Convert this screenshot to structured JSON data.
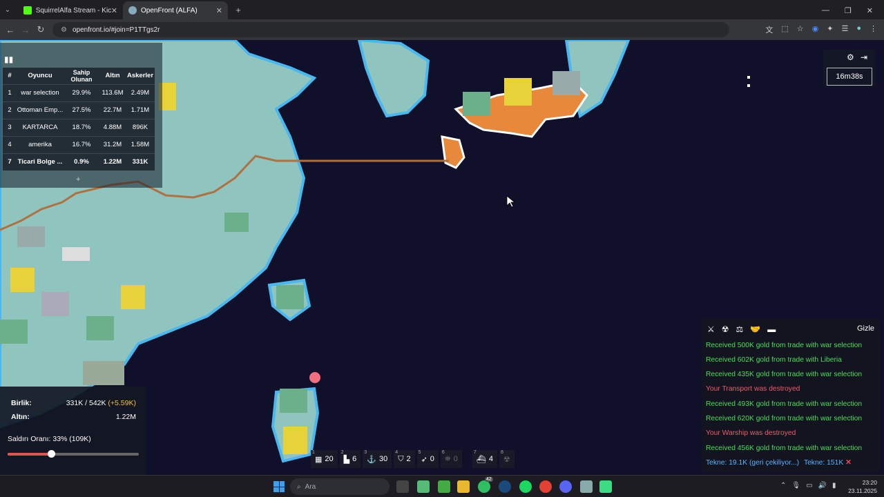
{
  "browser": {
    "tabs": [
      {
        "title": "SquirrelAlfa Stream - Kick Dashb"
      },
      {
        "title": "OpenFront (ALFA)"
      }
    ],
    "url": "openfront.io/#join=P1TTgs2r"
  },
  "leaderboard": {
    "headers": [
      "#",
      "Oyuncu",
      "Sahip Olunan",
      "Altın",
      "Askerler"
    ],
    "rows": [
      {
        "rank": "1",
        "player": "war selection",
        "owned": "29.9%",
        "gold": "113.6M",
        "troops": "2.49M"
      },
      {
        "rank": "2",
        "player": "Ottoman Emp...",
        "owned": "27.5%",
        "gold": "22.7M",
        "troops": "1.71M"
      },
      {
        "rank": "3",
        "player": "KARTARCA",
        "owned": "18.7%",
        "gold": "4.88M",
        "troops": "896K"
      },
      {
        "rank": "4",
        "player": "amerika",
        "owned": "16.7%",
        "gold": "31.2M",
        "troops": "1.58M"
      },
      {
        "rank": "7",
        "player": "Ticari Bolge ...",
        "owned": "0.9%",
        "gold": "1.22M",
        "troops": "331K"
      }
    ],
    "expand_label": "+"
  },
  "timer": "16m38s",
  "stats": {
    "troops_label": "Birlik:",
    "troops_value": "331K / 542K",
    "troops_gain": "(+5.59K)",
    "gold_label": "Altın:",
    "gold_value": "1.22M",
    "attack_label": "Saldırı Oranı: 33% (109K)",
    "attack_ratio": 0.33
  },
  "build_bar": [
    {
      "key": "1",
      "icon": "city-icon",
      "count": "20"
    },
    {
      "key": "2",
      "icon": "factory-icon",
      "count": "6"
    },
    {
      "key": "3",
      "icon": "port-icon",
      "count": "30"
    },
    {
      "key": "4",
      "icon": "defense-post-icon",
      "count": "2"
    },
    {
      "key": "5",
      "icon": "missile-silo-icon",
      "count": "0"
    },
    {
      "key": "6",
      "icon": "sam-launcher-icon",
      "count": "0"
    },
    {
      "key": "7",
      "icon": "warship-icon",
      "count": "4"
    },
    {
      "key": "8",
      "icon": "nuke-icon",
      "count": ""
    }
  ],
  "events": {
    "hide_label": "Gizle",
    "messages": [
      {
        "text": "Received 500K gold from trade with war selection",
        "type": "good"
      },
      {
        "text": "Received 602K gold from trade with Liberia",
        "type": "good"
      },
      {
        "text": "Received 435K gold from trade with war selection",
        "type": "good"
      },
      {
        "text": "Your Transport was destroyed",
        "type": "bad"
      },
      {
        "text": "Received 493K gold from trade with war selection",
        "type": "good"
      },
      {
        "text": "Received 620K gold from trade with war selection",
        "type": "good"
      },
      {
        "text": "Your Warship was destroyed",
        "type": "bad"
      },
      {
        "text": "Received 456K gold from trade with war selection",
        "type": "good"
      }
    ],
    "boat1": "Tekne: 19.1K (geri çekiliyor...)",
    "boat2": "Tekne: 151K",
    "cancel": "✕"
  },
  "taskbar": {
    "search_placeholder": "Ara",
    "time": "23:20",
    "date": "23.11.2025",
    "badge": "42"
  },
  "colors": {
    "good": "#4ade58",
    "bad": "#f05a6a",
    "land": "#8fc4bf",
    "border": "#4ab8f0",
    "player_territory": "#e8883a"
  }
}
